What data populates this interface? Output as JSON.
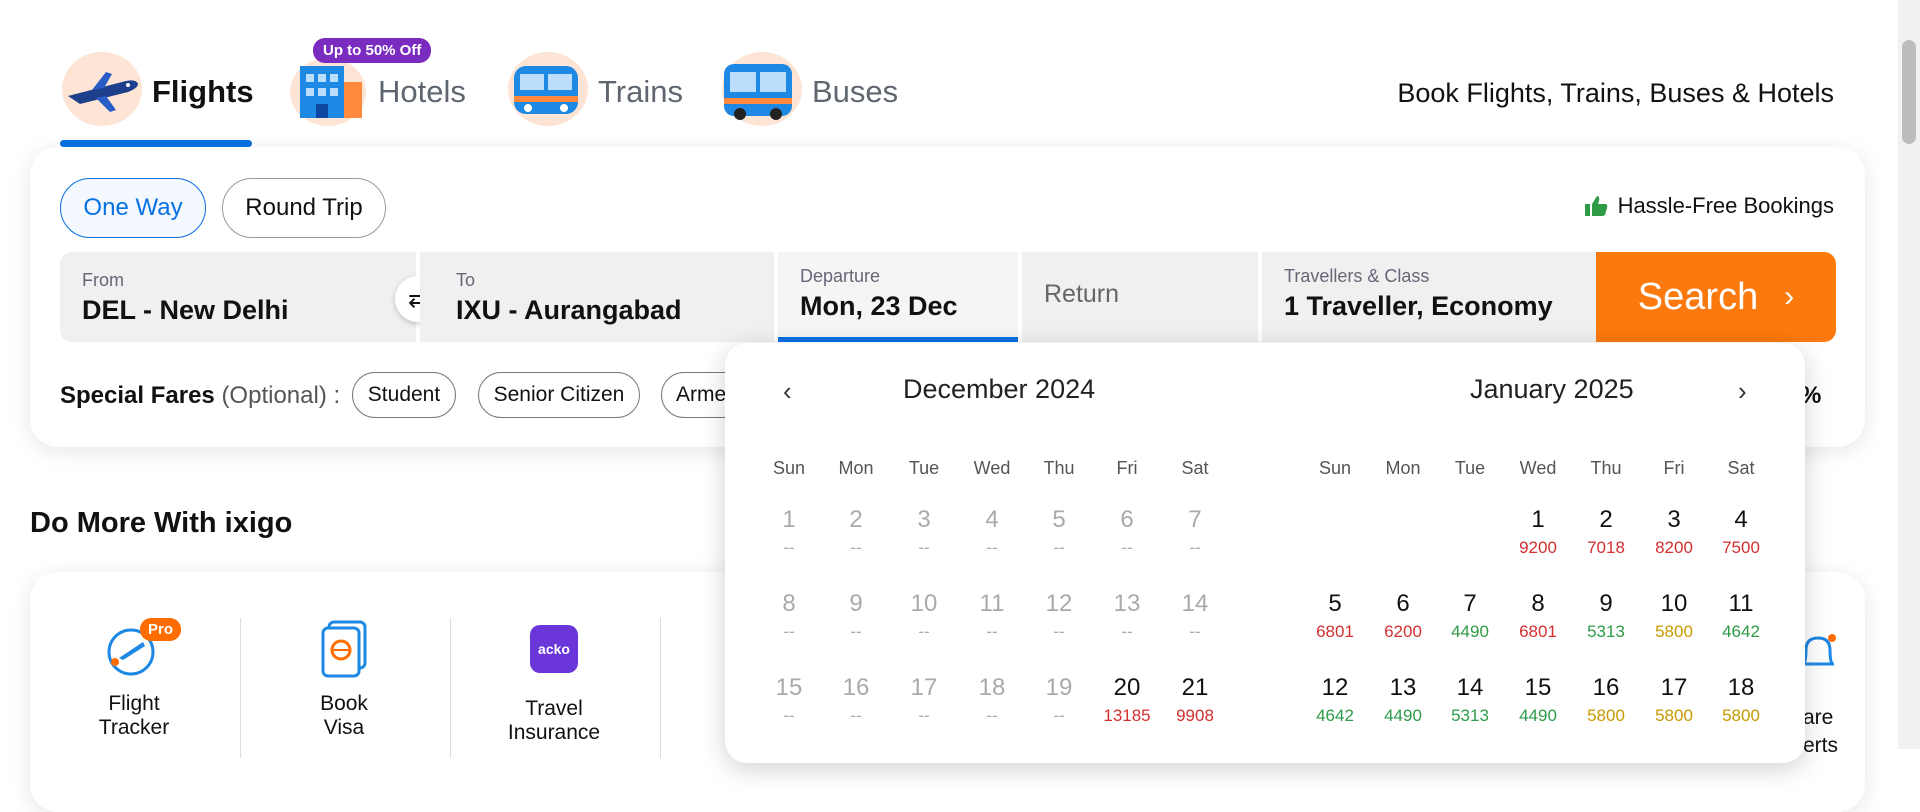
{
  "nav": {
    "tabs": [
      {
        "label": "Flights",
        "icon": "airplane-icon"
      },
      {
        "label": "Hotels",
        "icon": "hotel-icon"
      },
      {
        "label": "Trains",
        "icon": "train-icon"
      },
      {
        "label": "Buses",
        "icon": "bus-icon"
      }
    ],
    "hotels_badge": "Up to 50% Off",
    "tagline": "Book Flights, Trains, Buses & Hotels"
  },
  "trip_type": {
    "one_way": "One Way",
    "round_trip": "Round Trip"
  },
  "hassle_free": "Hassle-Free Bookings",
  "search": {
    "from_label": "From",
    "from_value": "DEL - New Delhi",
    "to_label": "To",
    "to_value": "IXU - Aurangabad",
    "departure_label": "Departure",
    "departure_value": "Mon, 23 Dec",
    "return_placeholder": "Return",
    "travellers_label": "Travellers & Class",
    "travellers_value": "1 Traveller, Economy",
    "button": "Search"
  },
  "special_fares": {
    "label": "Special Fares",
    "optional": "(Optional) :",
    "options": [
      "Student",
      "Senior Citizen",
      "Arme"
    ],
    "trailing": "%"
  },
  "do_more": {
    "title": "Do More With ixigo",
    "services": [
      {
        "label_line1": "Flight",
        "label_line2": "Tracker",
        "icon": "flight-tracker-icon",
        "badge": "Pro"
      },
      {
        "label_line1": "Book",
        "label_line2": "Visa",
        "icon": "passport-icon"
      },
      {
        "label_line1": "Travel",
        "label_line2": "Insurance",
        "icon": "acko-icon",
        "icon_text": "acko"
      }
    ],
    "alerts_label": "are\nerts"
  },
  "calendar": {
    "left_month": "December 2024",
    "right_month": "January 2025",
    "weekdays": [
      "Sun",
      "Mon",
      "Tue",
      "Wed",
      "Thu",
      "Fri",
      "Sat"
    ],
    "colors": {
      "high": "#d32f2f",
      "medium": "#c79a00",
      "low": "#2e9b47",
      "disabled": "#aaaaaa"
    },
    "dec": [
      [
        {
          "d": "1",
          "p": "--",
          "c": "disabled"
        },
        {
          "d": "2",
          "p": "--",
          "c": "disabled"
        },
        {
          "d": "3",
          "p": "--",
          "c": "disabled"
        },
        {
          "d": "4",
          "p": "--",
          "c": "disabled"
        },
        {
          "d": "5",
          "p": "--",
          "c": "disabled"
        },
        {
          "d": "6",
          "p": "--",
          "c": "disabled"
        },
        {
          "d": "7",
          "p": "--",
          "c": "disabled"
        }
      ],
      [
        {
          "d": "8",
          "p": "--",
          "c": "disabled"
        },
        {
          "d": "9",
          "p": "--",
          "c": "disabled"
        },
        {
          "d": "10",
          "p": "--",
          "c": "disabled"
        },
        {
          "d": "11",
          "p": "--",
          "c": "disabled"
        },
        {
          "d": "12",
          "p": "--",
          "c": "disabled"
        },
        {
          "d": "13",
          "p": "--",
          "c": "disabled"
        },
        {
          "d": "14",
          "p": "--",
          "c": "disabled"
        }
      ],
      [
        {
          "d": "15",
          "p": "--",
          "c": "disabled"
        },
        {
          "d": "16",
          "p": "--",
          "c": "disabled"
        },
        {
          "d": "17",
          "p": "--",
          "c": "disabled"
        },
        {
          "d": "18",
          "p": "--",
          "c": "disabled"
        },
        {
          "d": "19",
          "p": "--",
          "c": "disabled"
        },
        {
          "d": "20",
          "p": "13185",
          "c": "high"
        },
        {
          "d": "21",
          "p": "9908",
          "c": "high"
        }
      ]
    ],
    "jan": [
      [
        null,
        null,
        null,
        {
          "d": "1",
          "p": "9200",
          "c": "high"
        },
        {
          "d": "2",
          "p": "7018",
          "c": "high"
        },
        {
          "d": "3",
          "p": "8200",
          "c": "high"
        },
        {
          "d": "4",
          "p": "7500",
          "c": "high"
        }
      ],
      [
        {
          "d": "5",
          "p": "6801",
          "c": "high"
        },
        {
          "d": "6",
          "p": "6200",
          "c": "high"
        },
        {
          "d": "7",
          "p": "4490",
          "c": "low"
        },
        {
          "d": "8",
          "p": "6801",
          "c": "high"
        },
        {
          "d": "9",
          "p": "5313",
          "c": "low"
        },
        {
          "d": "10",
          "p": "5800",
          "c": "medium"
        },
        {
          "d": "11",
          "p": "4642",
          "c": "low"
        }
      ],
      [
        {
          "d": "12",
          "p": "4642",
          "c": "low"
        },
        {
          "d": "13",
          "p": "4490",
          "c": "low"
        },
        {
          "d": "14",
          "p": "5313",
          "c": "low"
        },
        {
          "d": "15",
          "p": "4490",
          "c": "low"
        },
        {
          "d": "16",
          "p": "5800",
          "c": "medium"
        },
        {
          "d": "17",
          "p": "5800",
          "c": "medium"
        },
        {
          "d": "18",
          "p": "5800",
          "c": "medium"
        }
      ]
    ]
  }
}
